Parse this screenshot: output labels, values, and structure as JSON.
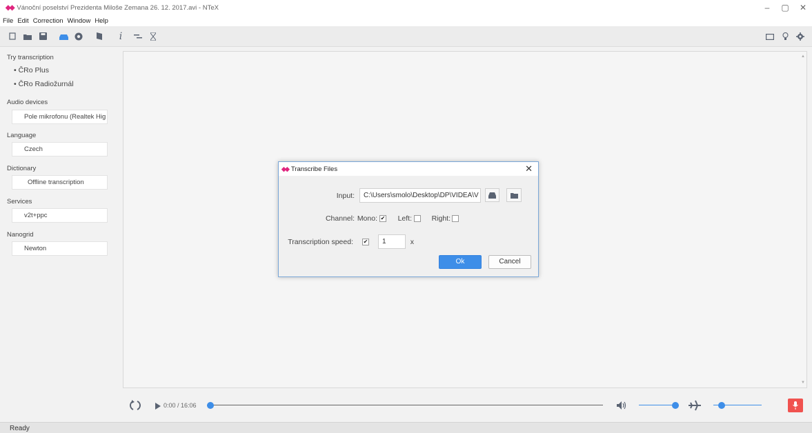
{
  "window": {
    "title": "Vánoční poselství Prezidenta Miloše Zemana 26. 12. 2017.avi - NTeX",
    "logo_glyph": "◆◆",
    "minimize": "–",
    "restore": "▢",
    "close": "✕"
  },
  "menu": [
    "File",
    "Edit",
    "Correction",
    "Window",
    "Help"
  ],
  "toolbar": {
    "info_glyph": "i",
    "accent_color": "#3e8ee8",
    "icon_color": "#5a6372"
  },
  "sidebar": {
    "try_transcription_label": "Try transcription",
    "try_items": [
      "• ČRo Plus",
      "• ČRo Radiožurnál"
    ],
    "audio_devices_label": "Audio devices",
    "audio_device_value": "Pole mikrofonu (Realtek Hig",
    "language_label": "Language",
    "language_value": "Czech",
    "dictionary_label": "Dictionary",
    "dictionary_value": "Offline transcription",
    "services_label": "Services",
    "services_value": "v2t+ppc",
    "nanogrid_label": "Nanogrid",
    "nanogrid_value": "Newton"
  },
  "player": {
    "time": "0:00 / 16:06",
    "progress": 0,
    "volume": 1.0,
    "speed_level": 0.12,
    "mic_color": "#f0524f"
  },
  "status": "Ready",
  "dialog": {
    "logo_glyph": "◆◆",
    "title": "Transcribe Files",
    "close": "✕",
    "input_label": "Input:",
    "input_value": "C:\\Users\\smolo\\Desktop\\DP\\VIDEA\\V",
    "channel_label": "Channel:",
    "mono_label": "Mono:",
    "mono_checked": true,
    "left_label": "Left:",
    "left_checked": false,
    "right_label": "Right:",
    "right_checked": false,
    "speed_label": "Transcription speed:",
    "speed_checked": true,
    "speed_value": "1",
    "speed_unit": "x",
    "ok_label": "Ok",
    "cancel_label": "Cancel",
    "check_glyph": "✔"
  }
}
